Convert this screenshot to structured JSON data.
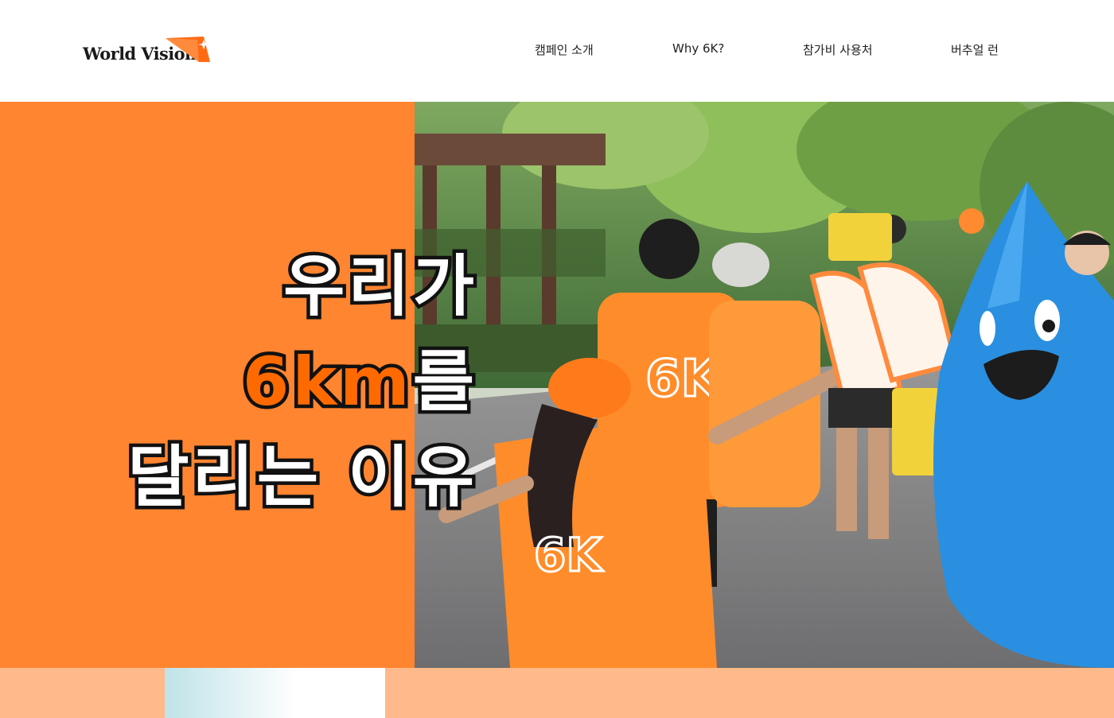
{
  "brand": {
    "name": "World Vision",
    "icon": "world-vision-star-mark-icon"
  },
  "nav": {
    "items": [
      {
        "label": "캠페인 소개"
      },
      {
        "label": "Why 6K?"
      },
      {
        "label": "참가비 사용처"
      },
      {
        "label": "버추얼 런"
      }
    ]
  },
  "hero": {
    "line1": "우리가",
    "line2_accent": "6km",
    "line2_rest": "를",
    "line3": "달리는 이유",
    "photo_icon": "charity-run-photo"
  },
  "colors": {
    "brand_orange": "#ff8531",
    "accent_text_orange": "#ff6a00",
    "headline_white": "#ffffff",
    "outline_black": "#111111",
    "peach": "#ffb98a",
    "mascot_blue": "#2a8fe0",
    "shirt_orange": "#ff8c2a"
  }
}
